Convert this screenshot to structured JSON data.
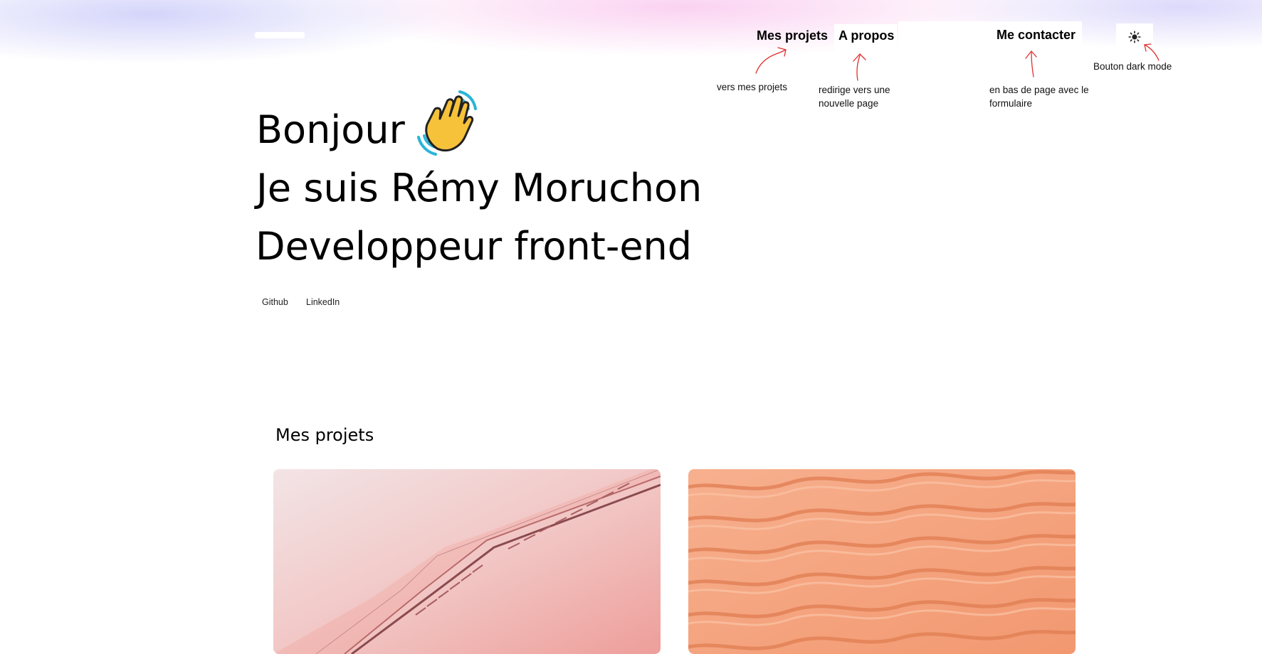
{
  "nav": {
    "items": [
      {
        "label": "Mes projets"
      },
      {
        "label": "A propos"
      },
      {
        "label": "Me contacter"
      }
    ],
    "theme_icon": "sun-icon"
  },
  "annotations": {
    "projects": [
      "vers mes projets"
    ],
    "about": [
      "redirige vers une",
      "nouvelle page"
    ],
    "contact": [
      "en bas de page avec le",
      "formulaire"
    ],
    "darkmode": [
      "Bouton dark mode"
    ]
  },
  "hero": {
    "greeting": "Bonjour",
    "greeting_icon": "waving-hand-icon",
    "intro": "Je suis Rémy Moruchon",
    "role": "Developpeur front-end"
  },
  "social": {
    "github": "Github",
    "linkedin": "LinkedIn"
  },
  "projects": {
    "title": "Mes projets",
    "cards": [
      {
        "image": "pink-escalator-image"
      },
      {
        "image": "orange-sand-dunes-image"
      }
    ]
  },
  "colors": {
    "annotation_red": "#e03030",
    "card1_base": "#f3c8c4",
    "card2_base": "#f6a27c"
  }
}
